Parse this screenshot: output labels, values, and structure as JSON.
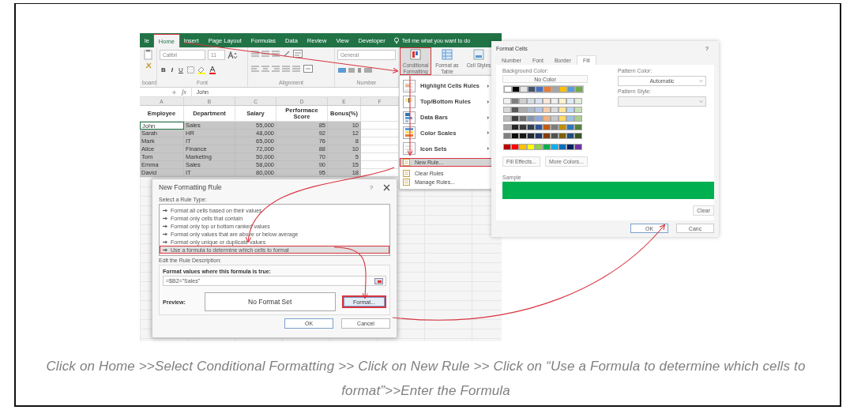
{
  "excel": {
    "tabs": [
      {
        "label": "le",
        "selected": false,
        "highlighted": false
      },
      {
        "label": "Home",
        "selected": true,
        "highlighted": true
      },
      {
        "label": "Insert",
        "selected": false,
        "highlighted": false
      },
      {
        "label": "Page Layout",
        "selected": false,
        "highlighted": false
      },
      {
        "label": "Formulas",
        "selected": false,
        "highlighted": false
      },
      {
        "label": "Data",
        "selected": false,
        "highlighted": false
      },
      {
        "label": "Review",
        "selected": false,
        "highlighted": false
      },
      {
        "label": "View",
        "selected": false,
        "highlighted": false
      },
      {
        "label": "Developer",
        "selected": false,
        "highlighted": false
      }
    ],
    "tell_me": "Tell me what you want to do",
    "font_name": "Calibri",
    "font_size": "11",
    "number_format": "General",
    "format_buttons": [
      "B",
      "I",
      "U"
    ],
    "groups": [
      "board",
      "Font",
      "Alignment",
      "Number"
    ],
    "fx_label": "fx",
    "formula": "John",
    "columns": [
      "A",
      "B",
      "C",
      "D",
      "E",
      "F"
    ],
    "headers": [
      "Employee",
      "Department",
      "Salary",
      "Performace Score",
      "Bonus(%)"
    ],
    "rows": [
      {
        "cells": [
          "John",
          "Sales",
          "55,000",
          "85",
          "10"
        ],
        "selected": true,
        "active": true
      },
      {
        "cells": [
          "Sarah",
          "HR",
          "48,000",
          "92",
          "12"
        ],
        "selected": true,
        "active": false
      },
      {
        "cells": [
          "Mark",
          "IT",
          "65,000",
          "76",
          "8"
        ],
        "selected": true,
        "active": false
      },
      {
        "cells": [
          "Alice",
          "Finance",
          "72,000",
          "88",
          "10"
        ],
        "selected": true,
        "active": false
      },
      {
        "cells": [
          "Tom",
          "Marketing",
          "50,000",
          "70",
          "5"
        ],
        "selected": true,
        "active": false
      },
      {
        "cells": [
          "Emma",
          "Sales",
          "58,000",
          "90",
          "15"
        ],
        "selected": true,
        "active": false
      },
      {
        "cells": [
          "David",
          "IT",
          "80,000",
          "95",
          "18"
        ],
        "selected": true,
        "active": false
      }
    ],
    "styles_buttons": [
      {
        "label": "Conditional Formatting",
        "kind": "conditional",
        "highlighted": true
      },
      {
        "label": "Format as Table",
        "kind": "table",
        "highlighted": false
      },
      {
        "label": "Cell Styles",
        "kind": "styles",
        "highlighted": false
      }
    ],
    "menu": [
      {
        "label": "Highlight Cells Rules",
        "kind": "submenu",
        "highlighted": false
      },
      {
        "label": "Top/Bottom Rules",
        "kind": "submenu",
        "highlighted": false
      },
      {
        "label": "Data Bars",
        "kind": "submenu",
        "highlighted": false
      },
      {
        "label": "Color Scales",
        "kind": "submenu",
        "highlighted": false
      },
      {
        "label": "Icon Sets",
        "kind": "submenu",
        "highlighted": false
      },
      {
        "label": "New Rule...",
        "kind": "command",
        "highlighted": true
      },
      {
        "label": "Clear Rules",
        "kind": "command",
        "highlighted": false
      },
      {
        "label": "Manage Rules...",
        "kind": "command",
        "highlighted": false
      }
    ]
  },
  "rule_dialog": {
    "title": "New Formatting Rule",
    "help": "?",
    "select_label": "Select a Rule Type:",
    "rule_types": [
      {
        "label": "Format all cells based on their values",
        "selected": false,
        "highlighted": false
      },
      {
        "label": "Format only cells that contain",
        "selected": false,
        "highlighted": false
      },
      {
        "label": "Format only top or bottom ranked values",
        "selected": false,
        "highlighted": false
      },
      {
        "label": "Format only values that are above or below average",
        "selected": false,
        "highlighted": false
      },
      {
        "label": "Format only unique or duplicate values",
        "selected": false,
        "highlighted": false
      },
      {
        "label": "Use a formula to determine which cells to format",
        "selected": true,
        "highlighted": true
      }
    ],
    "edit_label": "Edit the Rule Description:",
    "formula_label": "Format values where this formula is true:",
    "formula": "=$B2=\"Sales\"",
    "preview_label": "Preview:",
    "preview_text": "No Format Set",
    "format_button": {
      "label": "Format...",
      "highlighted": true
    },
    "buttons": [
      "OK",
      "Cancel"
    ]
  },
  "format_dialog": {
    "title": "Format Cells",
    "help": "?",
    "tabs": [
      {
        "label": "Number",
        "selected": false
      },
      {
        "label": "Font",
        "selected": false
      },
      {
        "label": "Border",
        "selected": false
      },
      {
        "label": "Fill",
        "selected": true
      }
    ],
    "background_label": "Background Color:",
    "no_color": "No Color",
    "theme_colors": [
      {
        "color": "#ffffff"
      },
      {
        "color": "#000000"
      },
      {
        "color": "#e7e6e6"
      },
      {
        "color": "#44546a"
      },
      {
        "color": "#4472c4"
      },
      {
        "color": "#ed7d31"
      },
      {
        "color": "#a5a5a5"
      },
      {
        "color": "#ffc000"
      },
      {
        "color": "#5b9bd5"
      },
      {
        "color": "#70ad47"
      }
    ],
    "shades": [
      {
        "swatches": [
          {
            "color": "#f2f2f2"
          },
          {
            "color": "#7f7f7f"
          },
          {
            "color": "#d0cece"
          },
          {
            "color": "#d6dce4"
          },
          {
            "color": "#d9e2f3"
          },
          {
            "color": "#fbe5d5"
          },
          {
            "color": "#ededed"
          },
          {
            "color": "#fff2cc"
          },
          {
            "color": "#deebf6"
          },
          {
            "color": "#e2efd9"
          }
        ]
      },
      {
        "swatches": [
          {
            "color": "#d8d8d8"
          },
          {
            "color": "#595959"
          },
          {
            "color": "#aeabab"
          },
          {
            "color": "#adb9ca"
          },
          {
            "color": "#b4c6e7"
          },
          {
            "color": "#f7cbac"
          },
          {
            "color": "#dbdbdb"
          },
          {
            "color": "#fee599"
          },
          {
            "color": "#bdd7ee"
          },
          {
            "color": "#c5e0b3"
          }
        ]
      },
      {
        "swatches": [
          {
            "color": "#bfbfbf"
          },
          {
            "color": "#3f3f3f"
          },
          {
            "color": "#757070"
          },
          {
            "color": "#8496b0"
          },
          {
            "color": "#8eaadb"
          },
          {
            "color": "#f4b183"
          },
          {
            "color": "#c9c9c9"
          },
          {
            "color": "#ffd965"
          },
          {
            "color": "#9cc3e5"
          },
          {
            "color": "#a8d08d"
          }
        ]
      },
      {
        "swatches": [
          {
            "color": "#a5a5a5"
          },
          {
            "color": "#262626"
          },
          {
            "color": "#3a3838"
          },
          {
            "color": "#323f4f"
          },
          {
            "color": "#2f5496"
          },
          {
            "color": "#c55a11"
          },
          {
            "color": "#7b7b7b"
          },
          {
            "color": "#bf8f00"
          },
          {
            "color": "#2e75b5"
          },
          {
            "color": "#538135"
          }
        ]
      },
      {
        "swatches": [
          {
            "color": "#7f7f7f"
          },
          {
            "color": "#0c0c0c"
          },
          {
            "color": "#171616"
          },
          {
            "color": "#222a35"
          },
          {
            "color": "#1f3864"
          },
          {
            "color": "#833c0b"
          },
          {
            "color": "#525252"
          },
          {
            "color": "#7f6000"
          },
          {
            "color": "#1e4e79"
          },
          {
            "color": "#375623"
          }
        ]
      }
    ],
    "standard_colors": [
      {
        "color": "#c00000"
      },
      {
        "color": "#ff0000"
      },
      {
        "color": "#ffc000"
      },
      {
        "color": "#ffff00"
      },
      {
        "color": "#92d050"
      },
      {
        "color": "#00b050"
      },
      {
        "color": "#00b0f0"
      },
      {
        "color": "#0070c0"
      },
      {
        "color": "#002060"
      },
      {
        "color": "#7030a0"
      }
    ],
    "fill_effects": "Fill Effects...",
    "more_colors": "More Colors...",
    "pattern_color_label": "Pattern Color:",
    "pattern_color": "Automatic",
    "pattern_style_label": "Pattern Style:",
    "sample": {
      "label": "Sample",
      "color": "#00b050"
    },
    "clear": "Clear",
    "buttons": [
      "OK",
      "Canc"
    ]
  },
  "caption": "Click on Home >>Select Conditional Formatting >> Click on New Rule >> Click on “Use a Formula to determine which cells to format”>>Enter the Formula"
}
